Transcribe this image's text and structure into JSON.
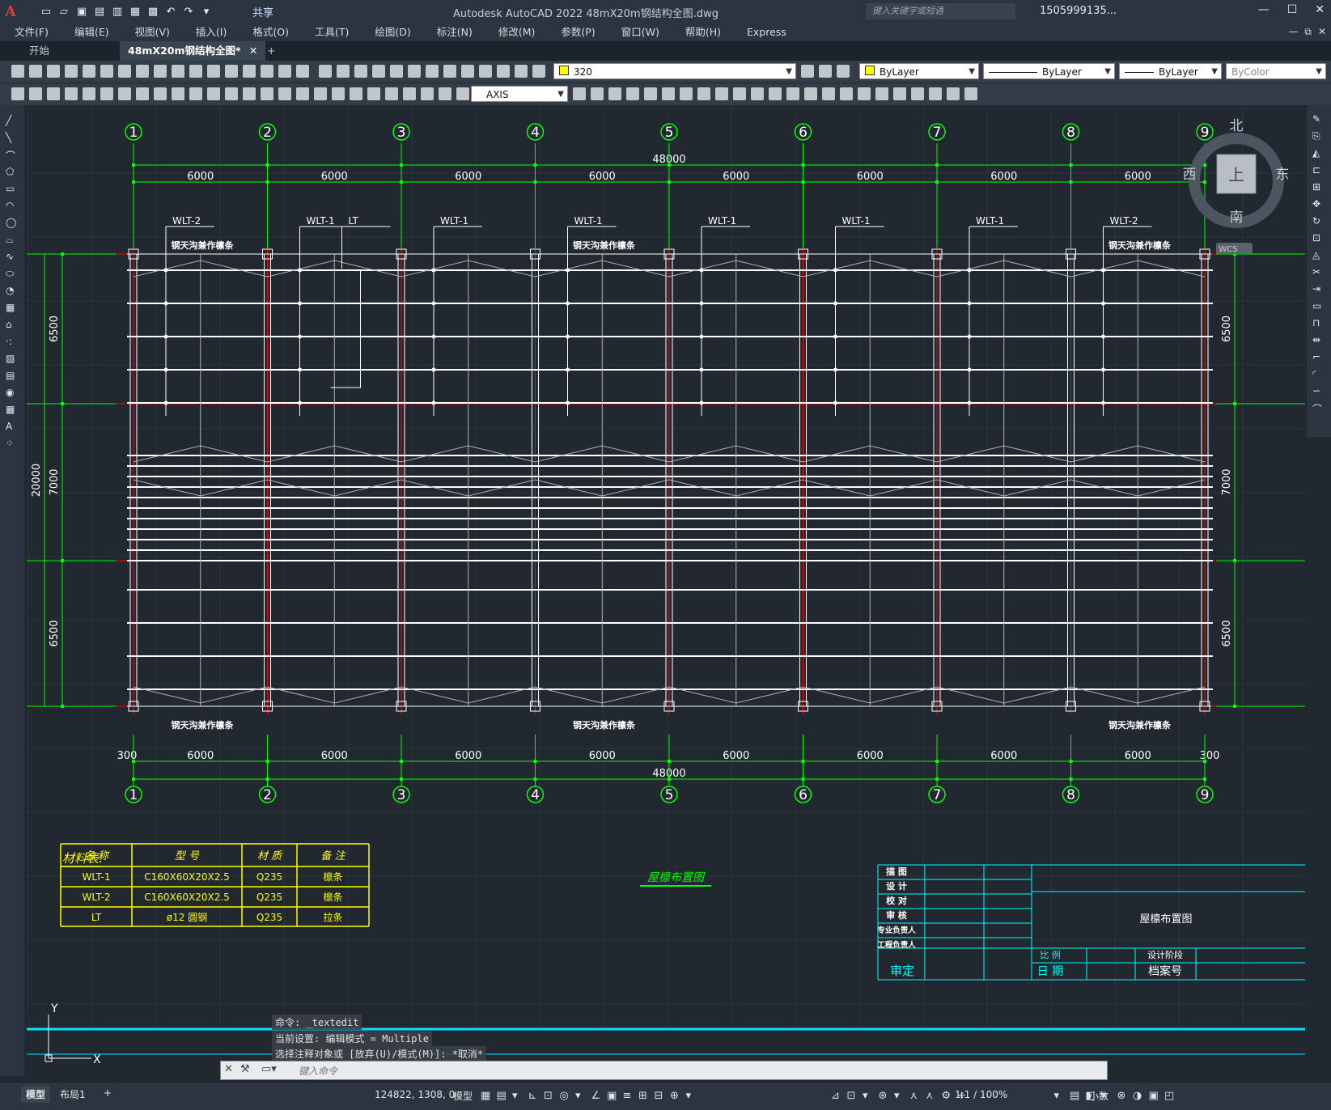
{
  "window": {
    "title": "Autodesk AutoCAD 2022    48mX20m钢结构全图.dwg",
    "share_label": "共享",
    "search_placeholder": "键入关键字或短语",
    "user": "1505999135...",
    "logo_text": "A"
  },
  "menu": [
    "文件(F)",
    "编辑(E)",
    "视图(V)",
    "插入(I)",
    "格式(O)",
    "工具(T)",
    "绘图(D)",
    "标注(N)",
    "修改(M)",
    "参数(P)",
    "窗口(W)",
    "帮助(H)",
    "Express"
  ],
  "tabs": {
    "start": "开始",
    "active": "48mX20m钢结构全图*",
    "close": "✕",
    "add": "+"
  },
  "toolbar": {
    "layer_value": "320",
    "color_value": "ByLayer",
    "linetype_value": "ByLayer",
    "lineweight_value": "ByLayer",
    "plotstyle_value": "ByColor",
    "textstyle_value": "AXIS"
  },
  "compass": {
    "n": "北",
    "s": "南",
    "e": "东",
    "w": "西",
    "center": "上",
    "wcs": "WCS"
  },
  "drawing": {
    "axis_labels": [
      "1",
      "2",
      "3",
      "4",
      "5",
      "6",
      "7",
      "8",
      "9"
    ],
    "total_span": "48000",
    "bay_span": "6000",
    "edge_offset": "300",
    "left_dims": [
      "6500",
      "7000",
      "6500"
    ],
    "total_depth": "20000",
    "purlin_labels": [
      "WLT-2",
      "WLT-1",
      "LT",
      "WLT-1",
      "WLT-1",
      "WLT-1",
      "WLT-1",
      "WLT-1",
      "WLT-2"
    ],
    "note": "钢天沟兼作檩条",
    "drawing_title": "屋檩布置图"
  },
  "material_table": {
    "title": "材料表:",
    "headers": [
      "名 称",
      "型 号",
      "材 质",
      "备 注"
    ],
    "rows": [
      [
        "WLT-1",
        "C160X60X20X2.5",
        "Q235",
        "檩条"
      ],
      [
        "WLT-2",
        "C160X60X20X2.5",
        "Q235",
        "檩条"
      ],
      [
        "LT",
        "ø12 圆钢",
        "Q235",
        "拉条"
      ]
    ]
  },
  "title_block": {
    "rows": [
      "描 图",
      "设 计",
      "校 对",
      "审 核",
      "专业负责人",
      "工程负责人"
    ],
    "approve": "审定",
    "scale": "比 例",
    "date": "日 期",
    "phase": "设计阶段",
    "archive": "档案号",
    "drawing_name": "屋檩布置图"
  },
  "command": {
    "history": [
      "命令: _textedit",
      "当前设置: 编辑模式 = Multiple",
      "选择注释对象或 [放弃(U)/模式(M)]: *取消*"
    ],
    "placeholder": "键入命令"
  },
  "status": {
    "model_tab": "模型",
    "layout_tab": "布局1",
    "add": "+",
    "coords": "124822, 1308, 0",
    "mode": "模型",
    "scale": "1:1 / 100%",
    "units": "小数"
  },
  "ucs": {
    "x": "X",
    "y": "Y"
  },
  "colors": {
    "green": "#00ff00",
    "red": "#ff0000",
    "white": "#ffffff",
    "yellow": "#ffff00",
    "cyan": "#00ffff",
    "canvas": "#212830"
  }
}
